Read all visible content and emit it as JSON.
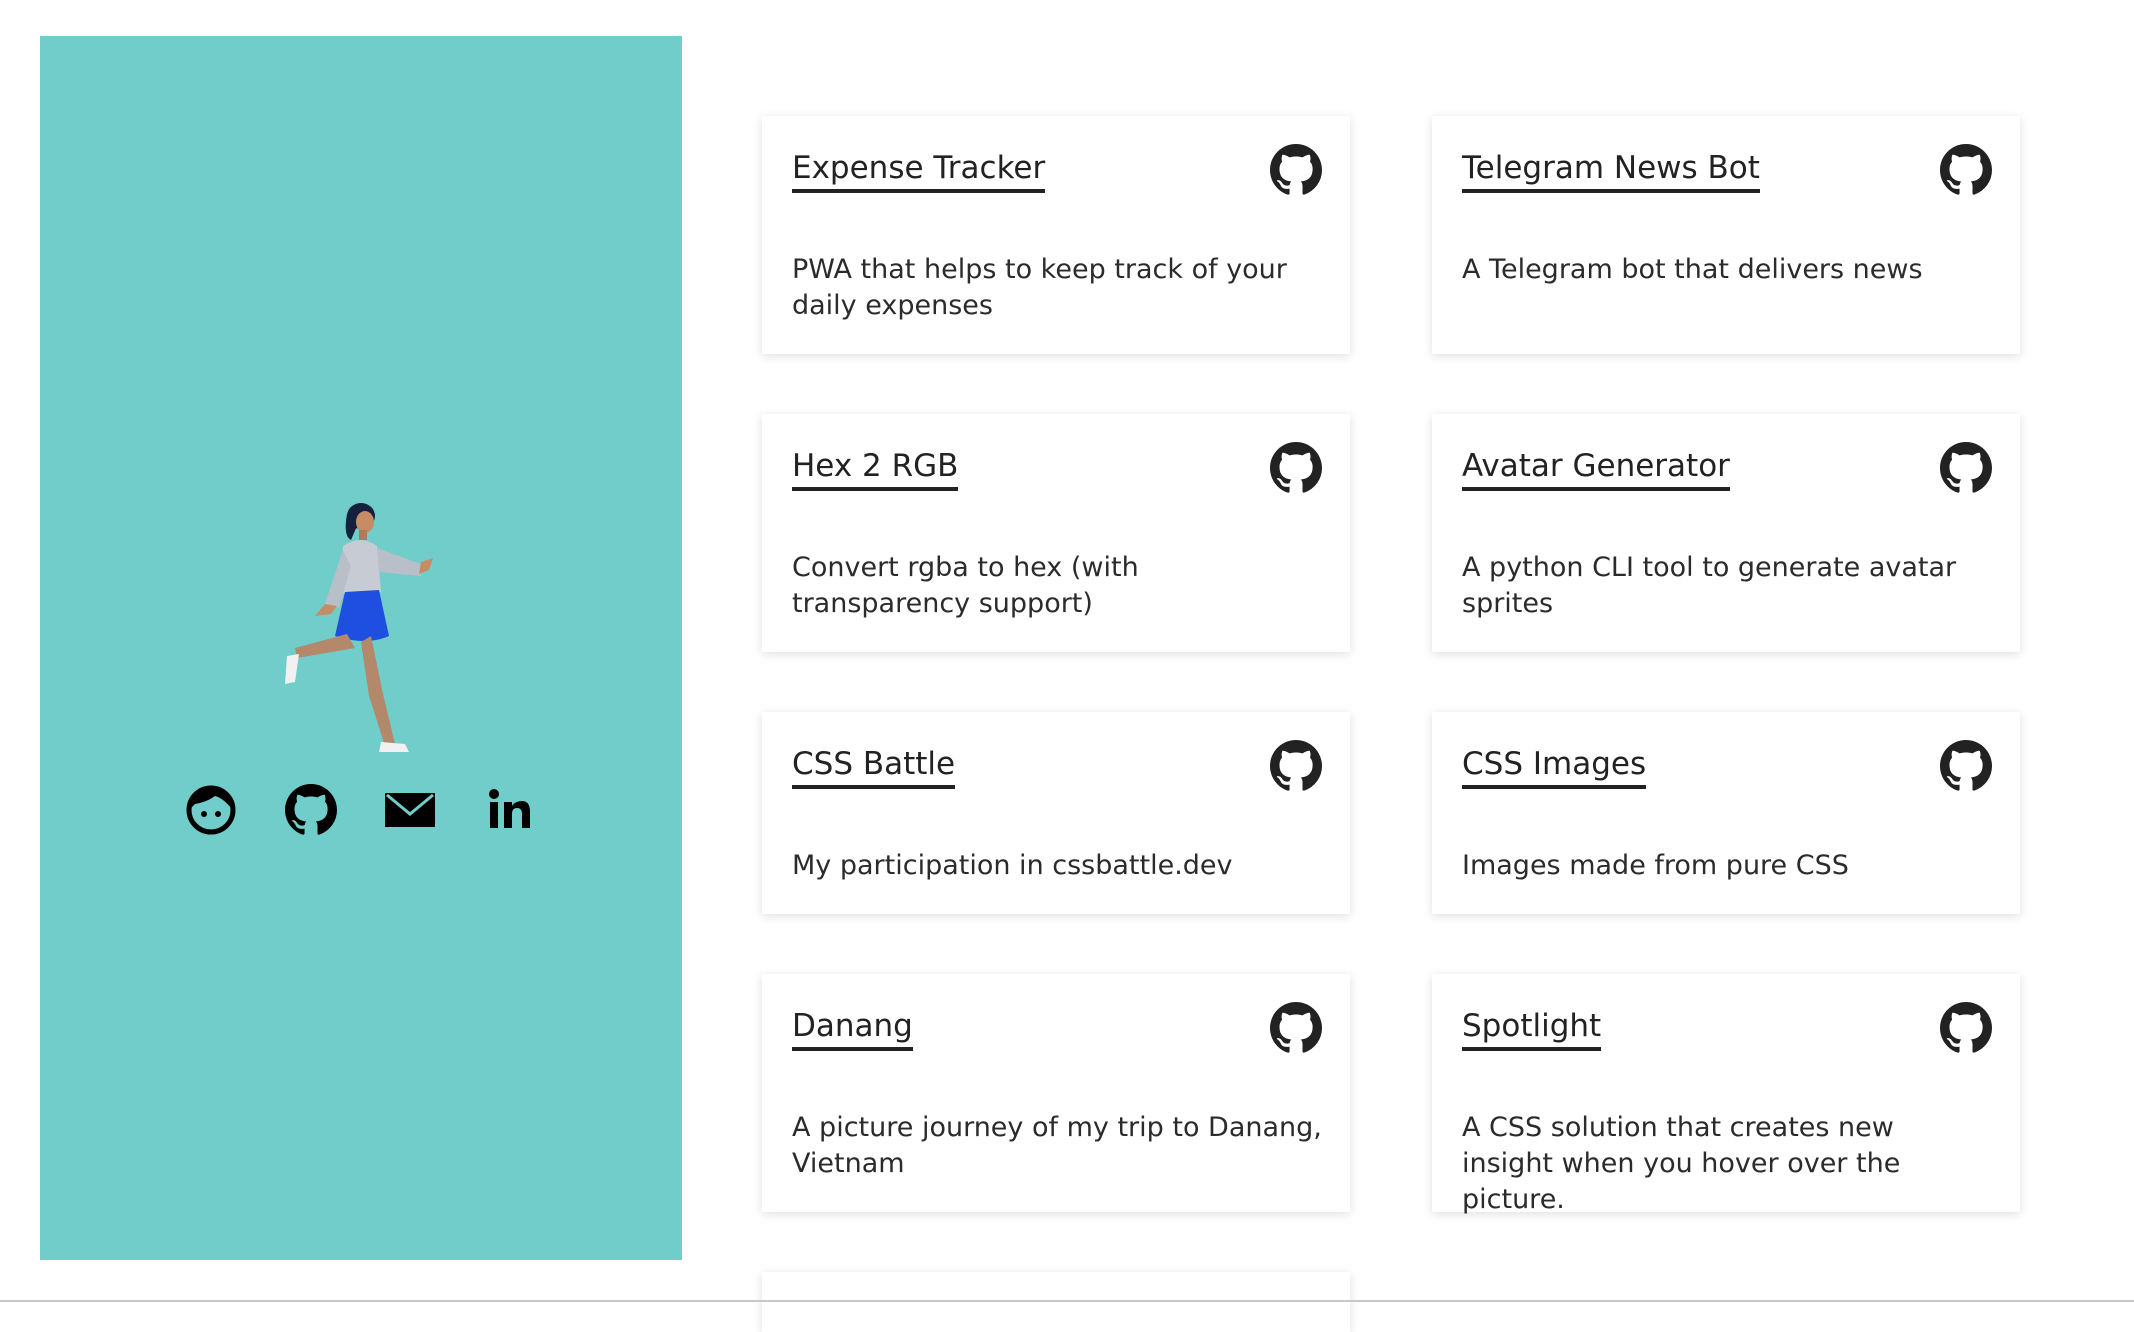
{
  "colors": {
    "sidebar_bg": "#71cdc9",
    "text": "#222222",
    "skirt": "#1e4fe0"
  },
  "sidebar": {
    "links": [
      {
        "icon": "face-icon"
      },
      {
        "icon": "github-icon"
      },
      {
        "icon": "mail-icon"
      },
      {
        "icon": "linkedin-icon"
      }
    ]
  },
  "projects": [
    {
      "title": "Expense Tracker",
      "description": "PWA that helps to keep track of your daily expenses",
      "icon": "github-icon"
    },
    {
      "title": "Telegram News Bot",
      "description": "A Telegram bot that delivers news",
      "icon": "github-icon"
    },
    {
      "title": "Hex 2 RGB",
      "description": "Convert rgba to hex (with transparency support)",
      "icon": "github-icon"
    },
    {
      "title": "Avatar Generator",
      "description": "A python CLI tool to generate avatar sprites",
      "icon": "github-icon"
    },
    {
      "title": "CSS Battle",
      "description": "My participation in cssbattle.dev",
      "icon": "github-icon"
    },
    {
      "title": "CSS Images",
      "description": "Images made from pure CSS",
      "icon": "github-icon"
    },
    {
      "title": "Danang",
      "description": "A picture journey of my trip to Danang, Vietnam",
      "icon": "github-icon"
    },
    {
      "title": "Spotlight",
      "description": "A CSS solution that creates new insight when you hover over the picture.",
      "icon": "github-icon"
    }
  ]
}
